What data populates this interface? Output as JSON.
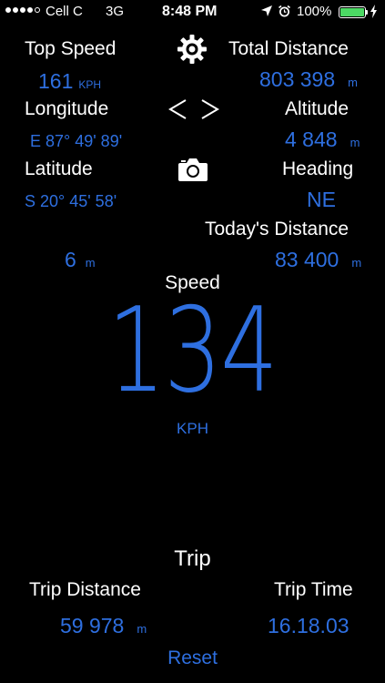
{
  "status_bar": {
    "carrier": "Cell C",
    "network": "3G",
    "time": "8:48 PM",
    "battery": "100%",
    "signal_bars_filled": 4,
    "signal_bars_total": 5
  },
  "stats": {
    "top_speed": {
      "label": "Top Speed",
      "value": "161",
      "unit": "KPH"
    },
    "total_distance": {
      "label": "Total Distance",
      "value": "803 398",
      "unit": "m"
    },
    "longitude": {
      "label": "Longitude",
      "value": "E 87° 49' 89'"
    },
    "altitude": {
      "label": "Altitude",
      "value": "4 848",
      "unit": "m"
    },
    "latitude": {
      "label": "Latitude",
      "value": "S 20° 45' 58'"
    },
    "heading": {
      "label": "Heading",
      "value": "NE"
    },
    "todays_distance": {
      "label": "Today's Distance",
      "value": "83 400",
      "unit": "m"
    },
    "accuracy": {
      "value": "6",
      "unit": "m"
    }
  },
  "speed": {
    "label": "Speed",
    "value": "134",
    "unit": "KPH"
  },
  "trip": {
    "title": "Trip",
    "distance_label": "Trip Distance",
    "distance_value": "59 978",
    "distance_unit": "m",
    "time_label": "Trip Time",
    "time_value": "16.18.03",
    "reset_label": "Reset"
  },
  "icons": {
    "settings": "gear-icon",
    "navigate": "chevron-left-right-icon",
    "camera": "camera-icon"
  },
  "colors": {
    "accent": "#2e6fe0",
    "background": "#000000",
    "battery": "#4cd964"
  }
}
